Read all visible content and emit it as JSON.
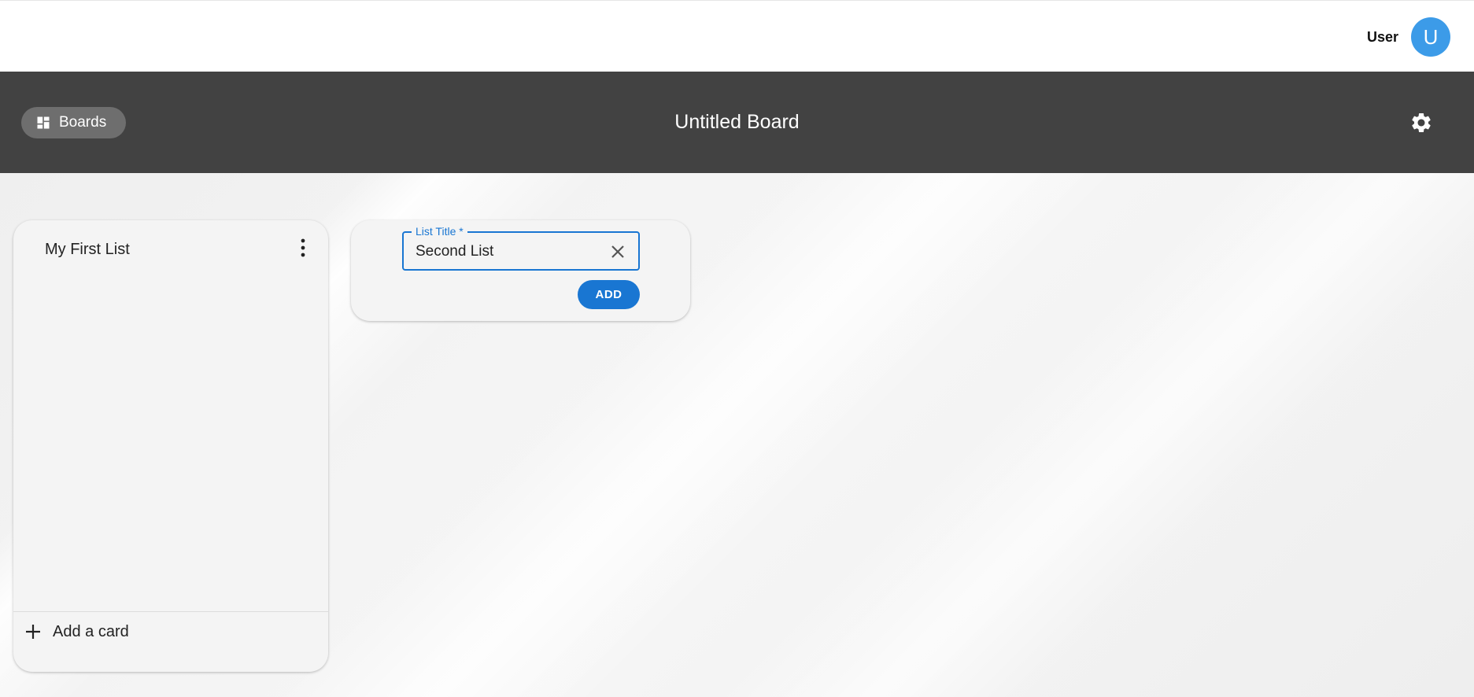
{
  "user": {
    "name": "User",
    "avatar_initial": "U"
  },
  "header": {
    "boards_label": "Boards",
    "board_title": "Untitled Board"
  },
  "lists": [
    {
      "title": "My First List",
      "add_card_label": "Add a card"
    }
  ],
  "new_list_form": {
    "field_label": "List Title *",
    "value": "Second List",
    "add_button_label": "ADD"
  },
  "colors": {
    "header_bg": "#424242",
    "accent": "#1976d2",
    "avatar": "#3c9be8"
  },
  "icons": [
    "dashboard-icon",
    "gear-icon",
    "more-vert-icon",
    "plus-icon",
    "close-icon"
  ]
}
